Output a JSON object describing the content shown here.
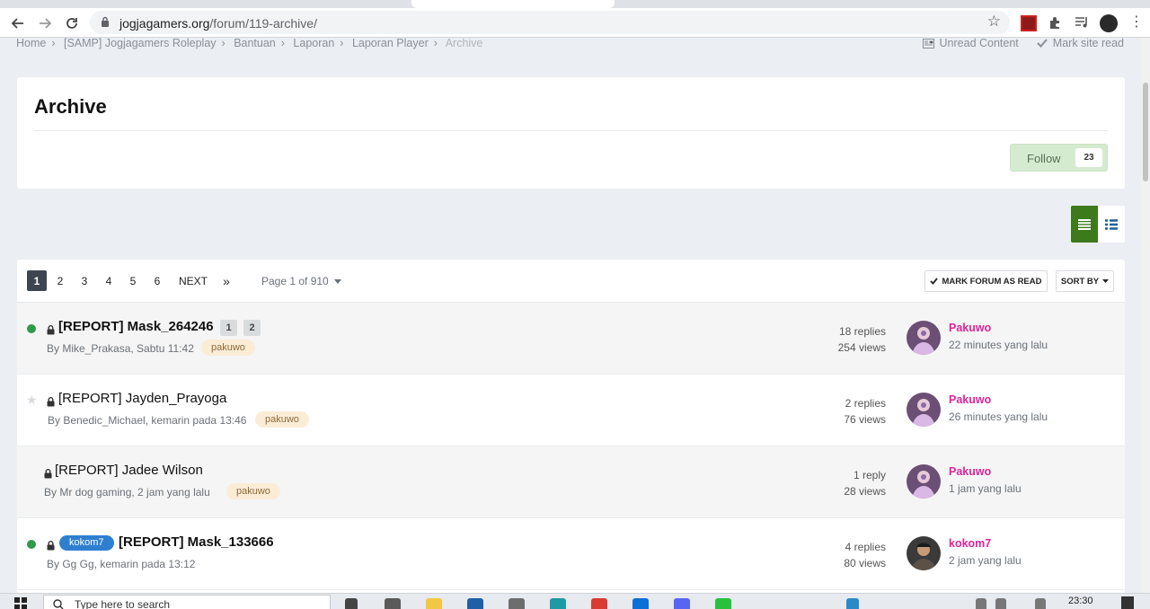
{
  "browser": {
    "url_host": "jogjagamers.org",
    "url_path": "/forum/119-archive/"
  },
  "breadcrumb": {
    "items": [
      "Home",
      "[SAMP] Jogjagamers Roleplay",
      "Bantuan",
      "Laporan",
      "Laporan Player"
    ],
    "current": "Archive",
    "unread_label": "Unread Content",
    "mark_read_label": "Mark site read"
  },
  "header": {
    "title": "Archive",
    "follow_label": "Follow",
    "follow_count": "23"
  },
  "pagination": {
    "pages": [
      "1",
      "2",
      "3",
      "4",
      "5",
      "6"
    ],
    "next_label": "NEXT",
    "last_label": "»",
    "info": "Page 1 of 910",
    "mark_forum_read": "MARK FORUM AS READ",
    "sort_by": "SORT BY"
  },
  "topics": [
    {
      "title": "[REPORT] Mask_264246",
      "pages": [
        "1",
        "2"
      ],
      "meta": "By Mike_Prakasa, Sabtu 11:42",
      "tag": "pakuwo",
      "replies": "18 replies",
      "views": "254 views",
      "last_user": "Pakuwo",
      "last_time": "22 minutes yang lalu"
    },
    {
      "title": "[REPORT] Jayden_Prayoga",
      "meta": "By Benedic_Michael, kemarin pada 13:46",
      "tag": "pakuwo",
      "replies": "2 replies",
      "views": "76 views",
      "last_user": "Pakuwo",
      "last_time": "26 minutes yang lalu"
    },
    {
      "title": "[REPORT] Jadee Wilson",
      "meta": "By Mr dog gaming, 2 jam yang lalu",
      "tag": "pakuwo",
      "replies": "1 reply",
      "views": "28 views",
      "last_user": "Pakuwo",
      "last_time": "1 jam yang lalu"
    },
    {
      "title": "[REPORT] Mask_133666",
      "prefix": "kokom7",
      "meta": "By Gg Gg, kemarin pada 13:12",
      "replies": "4 replies",
      "views": "80 views",
      "last_user": "kokom7",
      "last_time": "2 jam yang lalu"
    }
  ],
  "taskbar": {
    "search_placeholder": "Type here to search",
    "clock": "23:30"
  },
  "colors": {
    "accent_green": "#3c7a1b",
    "unread_dot": "#2f9a4a",
    "username_pink": "#e0239a",
    "prefix_blue": "#2f7fd0",
    "tag_bg": "#fbecd6"
  },
  "icons": [
    "back-icon",
    "forward-icon",
    "reload-icon",
    "lock-icon",
    "star-icon",
    "extension-icon",
    "menu-icon",
    "checkmark-icon",
    "caret-down-icon",
    "list-view-icon",
    "grid-view-icon",
    "locked-topic-icon",
    "unread-dot-icon",
    "search-icon",
    "windows-icon"
  ]
}
